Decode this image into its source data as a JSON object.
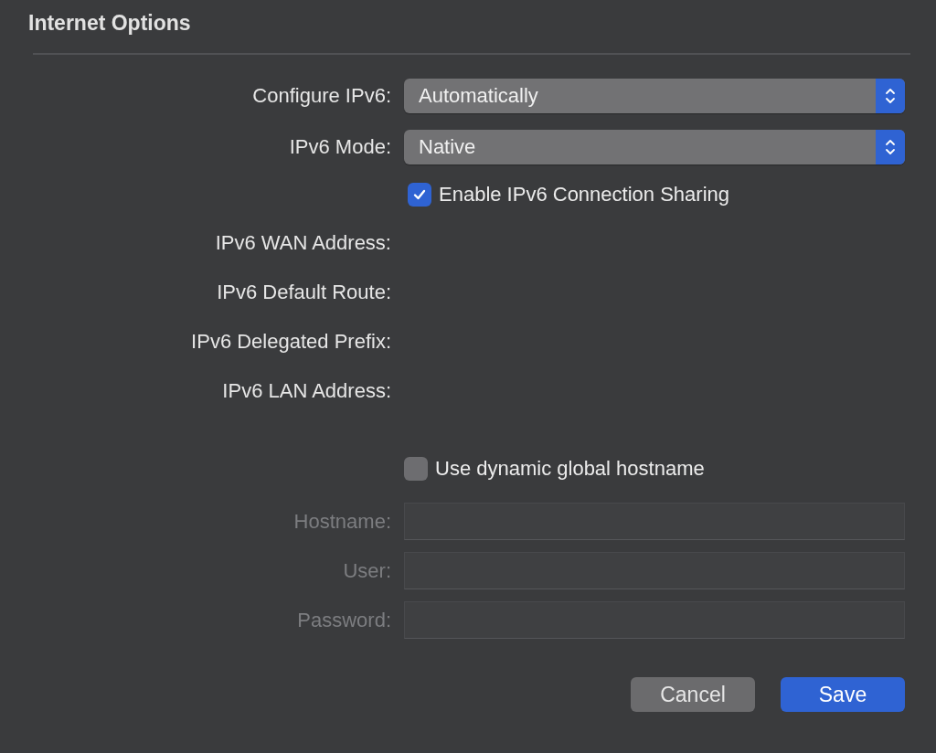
{
  "title": "Internet Options",
  "rows": [
    {
      "kind": "popup",
      "label": "Configure IPv6:",
      "value": "Automatically"
    },
    {
      "kind": "popup",
      "label": "IPv6 Mode:",
      "value": "Native"
    },
    {
      "kind": "checkbox",
      "text": "Enable IPv6 Connection Sharing",
      "checked": true
    },
    {
      "kind": "info",
      "label": "IPv6 WAN Address:"
    },
    {
      "kind": "info",
      "label": "IPv6 Default Route:"
    },
    {
      "kind": "info",
      "label": "IPv6 Delegated Prefix:"
    },
    {
      "kind": "info",
      "label": "IPv6 LAN Address:"
    },
    {
      "kind": "spacer"
    },
    {
      "kind": "checkbox",
      "text": "Use dynamic global hostname",
      "checked": false
    },
    {
      "kind": "field",
      "label": "Hostname:",
      "disabled": true
    },
    {
      "kind": "field",
      "label": "User:",
      "disabled": true
    },
    {
      "kind": "field",
      "label": "Password:",
      "disabled": true
    }
  ],
  "buttons": [
    {
      "label": "Cancel",
      "kind": "secondary"
    },
    {
      "label": "Save",
      "kind": "primary"
    }
  ]
}
